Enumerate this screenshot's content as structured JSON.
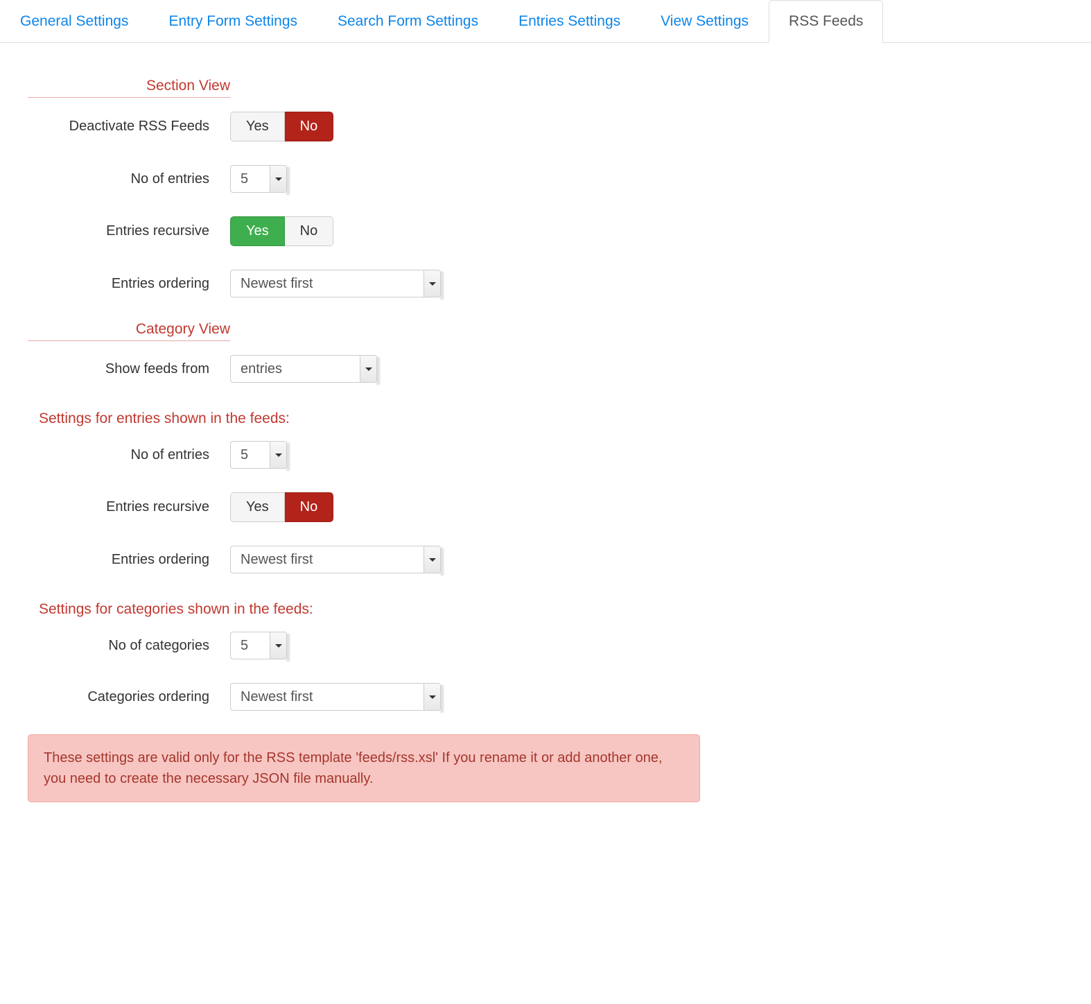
{
  "tabs": [
    {
      "label": "General Settings"
    },
    {
      "label": "Entry Form Settings"
    },
    {
      "label": "Search Form Settings"
    },
    {
      "label": "Entries Settings"
    },
    {
      "label": "View Settings"
    },
    {
      "label": "RSS Feeds"
    }
  ],
  "section_view": {
    "title": "Section View",
    "deactivate_label": "Deactivate RSS Feeds",
    "deactivate_yes": "Yes",
    "deactivate_no": "No",
    "no_entries_label": "No of entries",
    "no_entries_value": "5",
    "recursive_label": "Entries recursive",
    "recursive_yes": "Yes",
    "recursive_no": "No",
    "ordering_label": "Entries ordering",
    "ordering_value": "Newest first"
  },
  "category_view": {
    "title": "Category View",
    "show_feeds_label": "Show feeds from",
    "show_feeds_value": "entries",
    "entries_subtitle": "Settings for entries shown in the feeds:",
    "no_entries_label": "No of entries",
    "no_entries_value": "5",
    "recursive_label": "Entries recursive",
    "recursive_yes": "Yes",
    "recursive_no": "No",
    "ordering_label": "Entries ordering",
    "ordering_value": "Newest first",
    "categories_subtitle": "Settings for categories shown in the feeds:",
    "no_categories_label": "No of categories",
    "no_categories_value": "5",
    "cat_ordering_label": "Categories ordering",
    "cat_ordering_value": "Newest first"
  },
  "alert": "These settings are valid only for the RSS template 'feeds/rss.xsl' If you rename it or add another one, you need to create the necessary JSON file manually."
}
